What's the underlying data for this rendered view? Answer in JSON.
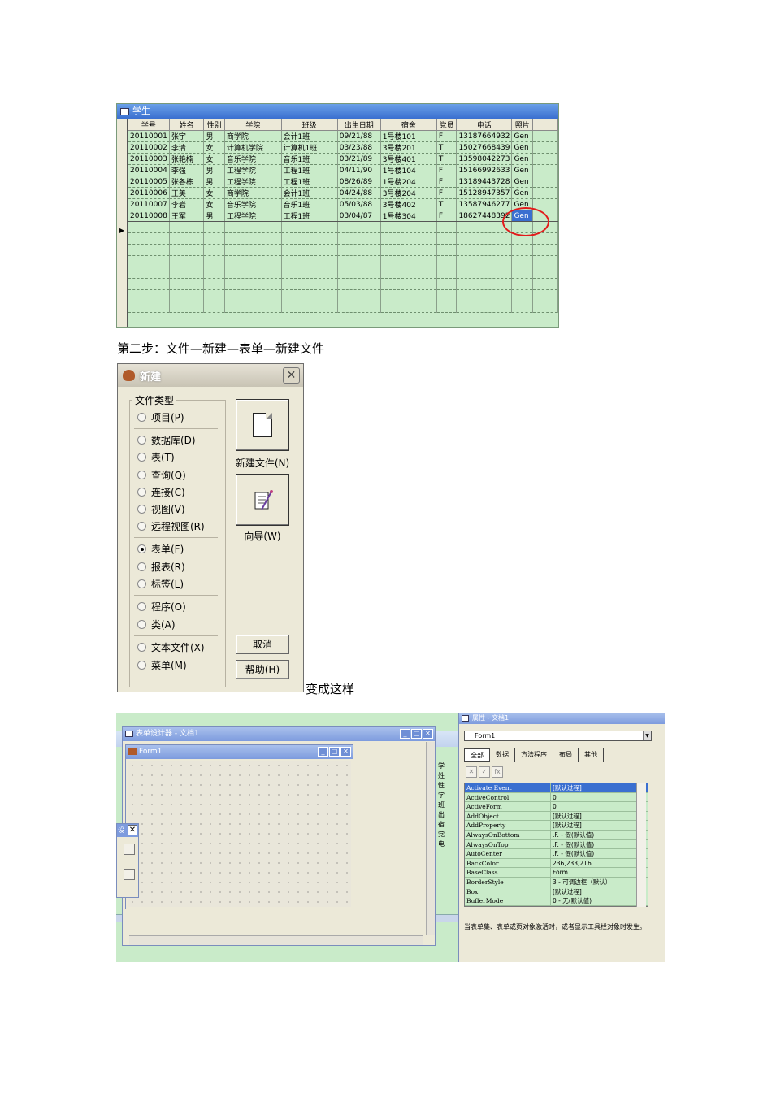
{
  "fig1": {
    "title": "学生",
    "headers": [
      "学号",
      "姓名",
      "性别",
      "学院",
      "班级",
      "出生日期",
      "宿舍",
      "党员",
      "电话",
      "照片"
    ],
    "rows": [
      [
        "20110001",
        "张宇",
        "男",
        "商学院",
        "会计1班",
        "09/21/88",
        "1号楼101",
        "F",
        "13187664932",
        "Gen"
      ],
      [
        "20110002",
        "李清",
        "女",
        "计算机学院",
        "计算机1班",
        "03/23/88",
        "3号楼201",
        "T",
        "15027668439",
        "Gen"
      ],
      [
        "20110003",
        "张艳楠",
        "女",
        "音乐学院",
        "音乐1班",
        "03/21/89",
        "3号楼401",
        "T",
        "13598042273",
        "Gen"
      ],
      [
        "20110004",
        "李强",
        "男",
        "工程学院",
        "工程1班",
        "04/11/90",
        "1号楼104",
        "F",
        "15166992633",
        "Gen"
      ],
      [
        "20110005",
        "张各栋",
        "男",
        "工程学院",
        "工程1班",
        "08/26/89",
        "1号楼204",
        "F",
        "13189443728",
        "Gen"
      ],
      [
        "20110006",
        "王美",
        "女",
        "商学院",
        "会计1班",
        "04/24/88",
        "3号楼204",
        "F",
        "15128947357",
        "Gen"
      ],
      [
        "20110007",
        "李岩",
        "女",
        "音乐学院",
        "音乐1班",
        "05/03/88",
        "3号楼402",
        "T",
        "13587946277",
        "Gen"
      ],
      [
        "20110008",
        "王军",
        "男",
        "工程学院",
        "工程1班",
        "03/04/87",
        "1号楼304",
        "F",
        "18627448392",
        "Gen"
      ]
    ]
  },
  "step2_text": "第二步：文件—新建—表单—新建文件",
  "fig2": {
    "title": "新建",
    "group_label": "文件类型",
    "options": [
      {
        "label": "项目(P)",
        "checked": false
      },
      {
        "label": "数据库(D)",
        "checked": false
      },
      {
        "label": "表(T)",
        "checked": false
      },
      {
        "label": "查询(Q)",
        "checked": false
      },
      {
        "label": "连接(C)",
        "checked": false
      },
      {
        "label": "视图(V)",
        "checked": false
      },
      {
        "label": "远程视图(R)",
        "checked": false
      },
      {
        "label": "表单(F)",
        "checked": true
      },
      {
        "label": "报表(R)",
        "checked": false
      },
      {
        "label": "标签(L)",
        "checked": false
      },
      {
        "label": "程序(O)",
        "checked": false
      },
      {
        "label": "类(A)",
        "checked": false
      },
      {
        "label": "文本文件(X)",
        "checked": false
      },
      {
        "label": "菜单(M)",
        "checked": false
      }
    ],
    "new_file_label": "新建文件(N)",
    "wizard_label": "向导(W)",
    "cancel_label": "取消",
    "help_label": "帮助(H)"
  },
  "becomes_text": "变成这样",
  "fig3": {
    "designer_title": "表单设计器 - 文档1",
    "form_title": "Form1",
    "toolbox_title": "设",
    "props_title": "属性 - 文档1",
    "object_select": "Form1",
    "tabs": [
      "全部",
      "数据",
      "方法程序",
      "布局",
      "其他"
    ],
    "left_labels": [
      "学",
      "姓",
      "性",
      "学",
      "班",
      "出",
      "宿",
      "党",
      "电"
    ],
    "properties": [
      {
        "name": "Activate Event",
        "value": "[默认过程]"
      },
      {
        "name": "ActiveControl",
        "value": "0"
      },
      {
        "name": "ActiveForm",
        "value": "0"
      },
      {
        "name": "AddObject",
        "value": "[默认过程]"
      },
      {
        "name": "AddProperty",
        "value": "[默认过程]"
      },
      {
        "name": "AlwaysOnBottom",
        "value": ".F. - 假(默认值)"
      },
      {
        "name": "AlwaysOnTop",
        "value": ".F. - 假(默认值)"
      },
      {
        "name": "AutoCenter",
        "value": ".F. - 假(默认值)"
      },
      {
        "name": "BackColor",
        "value": "236,233,216"
      },
      {
        "name": "BaseClass",
        "value": "Form"
      },
      {
        "name": "BorderStyle",
        "value": "3 - 可调边框（默认）"
      },
      {
        "name": "Box",
        "value": "[默认过程]"
      },
      {
        "name": "BufferMode",
        "value": "0 - 无(默认值)"
      }
    ],
    "description": "当表单集、表单或页对象激活时，或者显示工具栏对象时发生。"
  },
  "colors": {
    "grid_bg": "#c9ebc9",
    "title_blue": "#3a6fd0",
    "annotation_red": "#e21b1b",
    "dialog_bg": "#ece9d8"
  }
}
